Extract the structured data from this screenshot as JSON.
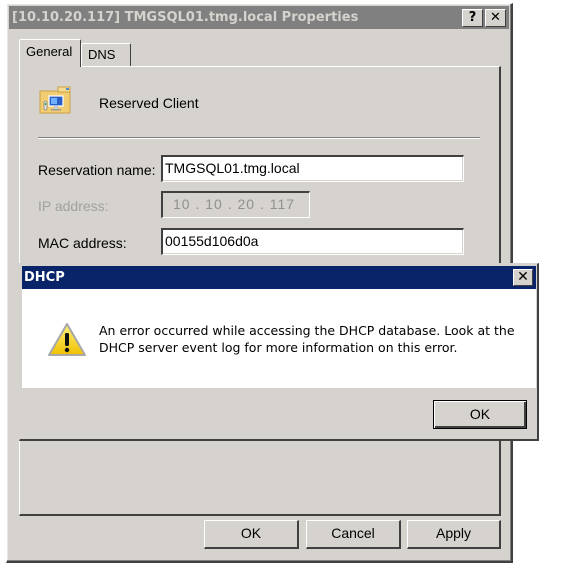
{
  "properties_dialog": {
    "title": "[10.10.20.117] TMGSQL01.tmg.local Properties",
    "help_button": "?",
    "close_button": "✕",
    "tabs": [
      {
        "label": "General",
        "active": true
      },
      {
        "label": "DNS",
        "active": false
      }
    ],
    "header": {
      "icon": "reserved-client-folder-icon",
      "label": "Reserved Client"
    },
    "fields": {
      "reservation_name": {
        "label": "Reservation name:",
        "value": "TMGSQL01.tmg.local"
      },
      "ip_address": {
        "label": "IP address:",
        "value": "10 . 10 . 20 . 117",
        "disabled": true
      },
      "mac_address": {
        "label": "MAC address:",
        "value": "00155d106d0a"
      }
    },
    "buttons": {
      "ok": "OK",
      "cancel": "Cancel",
      "apply": "Apply"
    }
  },
  "message_box": {
    "title": "DHCP",
    "close_button": "✕",
    "icon": "warning-icon",
    "message": "An error occurred while accessing the DHCP database. Look at the DHCP server event log for more information on this error.",
    "ok_button": "OK"
  },
  "colors": {
    "inactive_titlebar": "#808080",
    "active_titlebar": "#0a246a",
    "dialog_face": "#d6d3ce",
    "warning_yellow": "#f5d000"
  }
}
